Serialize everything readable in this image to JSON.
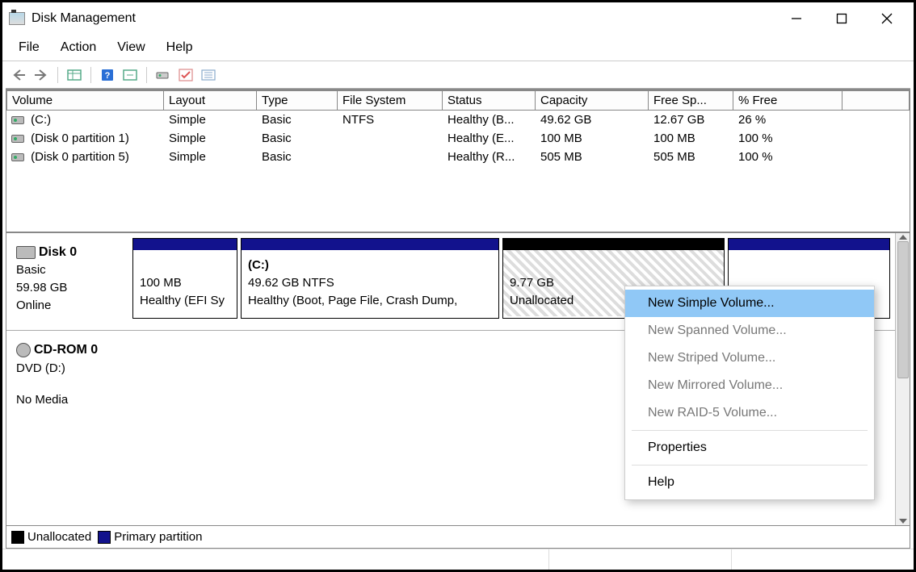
{
  "window": {
    "title": "Disk Management"
  },
  "menu": {
    "file": "File",
    "action": "Action",
    "view": "View",
    "help": "Help"
  },
  "columns": {
    "volume": "Volume",
    "layout": "Layout",
    "type": "Type",
    "fs": "File System",
    "status": "Status",
    "capacity": "Capacity",
    "free": "Free Sp...",
    "pct": "% Free"
  },
  "volumes": [
    {
      "name": "(C:)",
      "layout": "Simple",
      "type": "Basic",
      "fs": "NTFS",
      "status": "Healthy (B...",
      "capacity": "49.62 GB",
      "free": "12.67 GB",
      "pct": "26 %"
    },
    {
      "name": "(Disk 0 partition 1)",
      "layout": "Simple",
      "type": "Basic",
      "fs": "",
      "status": "Healthy (E...",
      "capacity": "100 MB",
      "free": "100 MB",
      "pct": "100 %"
    },
    {
      "name": "(Disk 0 partition 5)",
      "layout": "Simple",
      "type": "Basic",
      "fs": "",
      "status": "Healthy (R...",
      "capacity": "505 MB",
      "free": "505 MB",
      "pct": "100 %"
    }
  ],
  "disk0": {
    "name": "Disk 0",
    "type": "Basic",
    "size": "59.98 GB",
    "state": "Online",
    "p0": {
      "size": "100 MB",
      "status": "Healthy (EFI Sy"
    },
    "p1": {
      "label": "(C:)",
      "size": "49.62 GB NTFS",
      "status": "Healthy (Boot, Page File, Crash Dump,"
    },
    "p2": {
      "size": "9.77 GB",
      "status": "Unallocated"
    }
  },
  "cdrom": {
    "name": "CD-ROM 0",
    "drive": "DVD (D:)",
    "state": "No Media"
  },
  "legend": {
    "unalloc": "Unallocated",
    "primary": "Primary partition"
  },
  "context": {
    "simple": "New Simple Volume...",
    "spanned": "New Spanned Volume...",
    "striped": "New Striped Volume...",
    "mirrored": "New Mirrored Volume...",
    "raid5": "New RAID-5 Volume...",
    "properties": "Properties",
    "help": "Help"
  }
}
